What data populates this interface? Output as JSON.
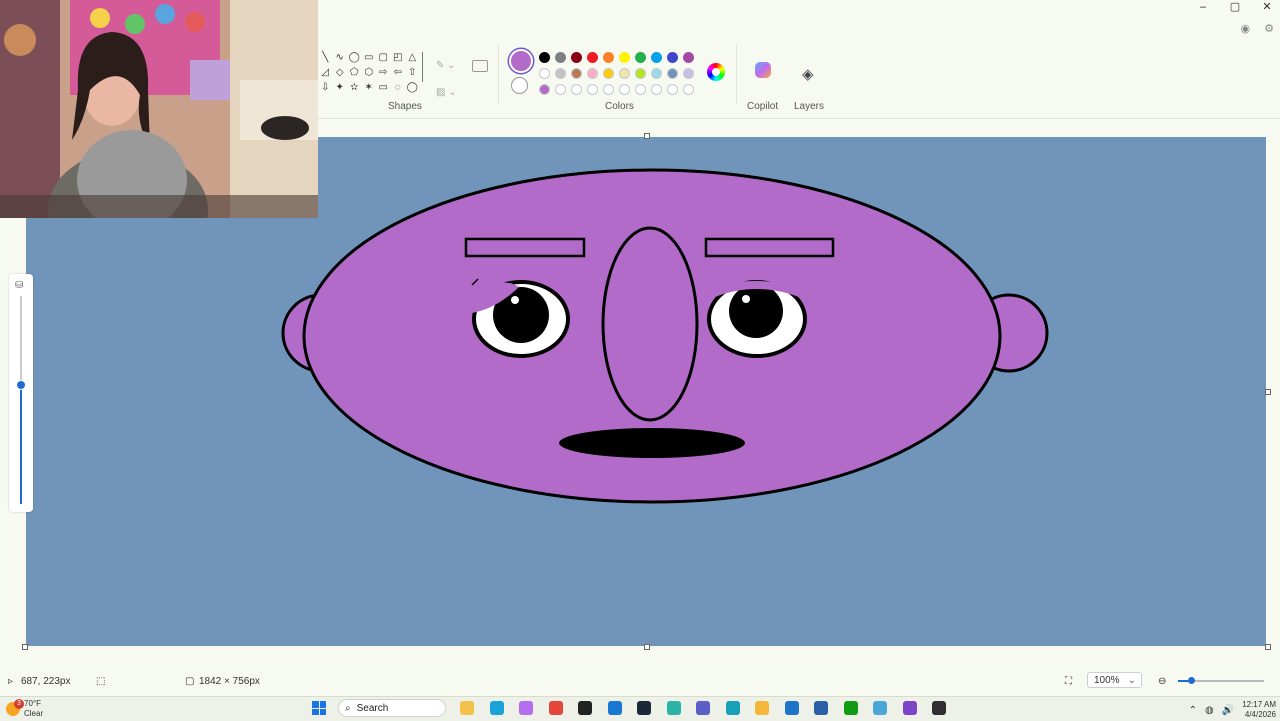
{
  "window": {
    "controls": [
      "–",
      "▢",
      "✕"
    ]
  },
  "ribbon": {
    "shapes_label": "Shapes",
    "colors_label": "Colors",
    "copilot_label": "Copilot",
    "layers_label": "Layers",
    "shape_glyphs": [
      "╲",
      "∿",
      "◯",
      "▭",
      "▢",
      "◰",
      "△",
      "◿",
      "◇",
      "⬠",
      "⬡",
      "⇨",
      "⇦",
      "⇧",
      "⇩",
      "✦",
      "✫",
      "✶",
      "▭",
      "◌",
      "◯"
    ],
    "selected_color_1": "#b36bc9",
    "selected_color_2": "#ffffff",
    "palette_row1": [
      "#000000",
      "#7f7f7f",
      "#880015",
      "#ed1c24",
      "#ff7f27",
      "#fff200",
      "#22b14c",
      "#00a2e8",
      "#3f48cc",
      "#a349a4"
    ],
    "palette_row2": [
      "#ffffff",
      "#c3c3c3",
      "#b97a57",
      "#ffaec9",
      "#ffc90e",
      "#efe4b0",
      "#b5e61d",
      "#99d9ea",
      "#7092be",
      "#c8bfe7"
    ],
    "palette_row3": [
      "#b36bc9",
      "#ffffff",
      "#ffffff",
      "#ffffff",
      "#ffffff",
      "#ffffff",
      "#ffffff",
      "#ffffff",
      "#ffffff",
      "#ffffff"
    ]
  },
  "canvas": {
    "background": "#7194bb",
    "face_color": "#b36bc9"
  },
  "status": {
    "cursor_pos": "687, 223px",
    "canvas_size": "1842 × 756px",
    "zoom": "100%"
  },
  "taskbar": {
    "temp": "70°F",
    "weather": "Clear",
    "badge": "3",
    "search_placeholder": "Search",
    "time": "12:17 AM",
    "date": "4/4/2026",
    "apps": [
      {
        "name": "file-explorer-app-icon",
        "color": "#f3c14b"
      },
      {
        "name": "edge-app-icon",
        "color": "#1aa3d9"
      },
      {
        "name": "copilot-app-icon",
        "color": "#b46cf0"
      },
      {
        "name": "chrome-app-icon",
        "color": "#e4473a"
      },
      {
        "name": "epic-app-icon",
        "color": "#222222"
      },
      {
        "name": "azure-app-icon",
        "color": "#1877d2"
      },
      {
        "name": "steam-app-icon",
        "color": "#1b2838"
      },
      {
        "name": "app-icon-8",
        "color": "#2bb3a5"
      },
      {
        "name": "teams-app-icon",
        "color": "#5b5fc7"
      },
      {
        "name": "app-icon-10",
        "color": "#18a0b8"
      },
      {
        "name": "files-app-icon",
        "color": "#f3b73a"
      },
      {
        "name": "mail-app-icon",
        "color": "#1e73c9"
      },
      {
        "name": "store-app-icon",
        "color": "#2b5fa8"
      },
      {
        "name": "xbox-app-icon",
        "color": "#139c13"
      },
      {
        "name": "paint-app-icon",
        "color": "#4ca6d9"
      },
      {
        "name": "visual-studio-app-icon",
        "color": "#7e44c6"
      },
      {
        "name": "obs-app-icon",
        "color": "#302e31"
      }
    ]
  }
}
